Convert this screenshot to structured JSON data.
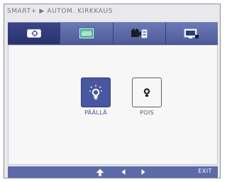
{
  "header": {
    "title": "SMART+ ▶ AUTOM. KIRKKAUS"
  },
  "tabs": [
    {
      "icon": "brightness-settings-icon",
      "active": true
    },
    {
      "icon": "contrast-ratio-icon",
      "active": false
    },
    {
      "icon": "camera-film-icon",
      "active": false
    },
    {
      "icon": "monitor-sensor-icon",
      "active": false
    }
  ],
  "options": {
    "on": {
      "label": "PÄÄLLÄ",
      "icon": "lightbulb-on-icon",
      "selected": true
    },
    "off": {
      "label": "POIS",
      "icon": "lightbulb-off-icon",
      "selected": false
    }
  },
  "footer": {
    "up_icon": "up-arrow-icon",
    "left_icon": "left-arrow-icon",
    "right_icon": "right-arrow-icon",
    "exit_label": "EXIT"
  },
  "colors": {
    "accent": "#4957a0",
    "tab_bar": "#5c6aa8",
    "panel": "#f7f7f8"
  }
}
